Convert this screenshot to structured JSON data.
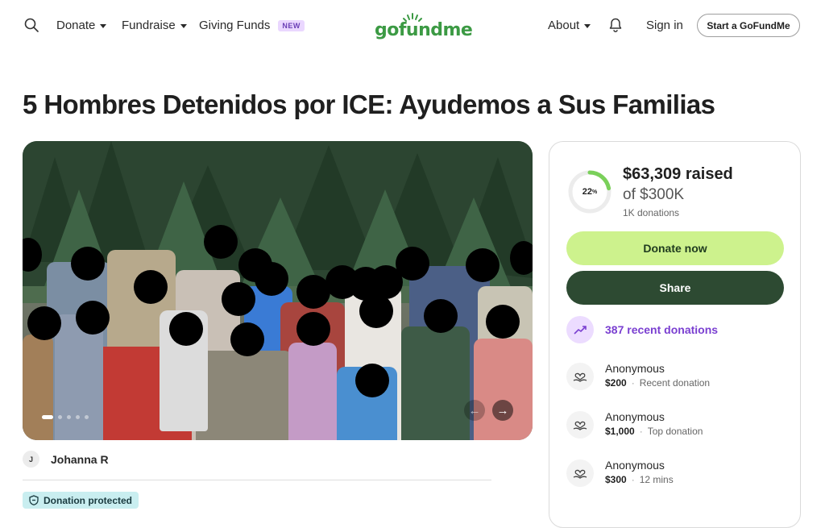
{
  "nav": {
    "donate": "Donate",
    "fundraise": "Fundraise",
    "giving_funds": "Giving Funds",
    "new_badge": "NEW",
    "logo": "gofundme",
    "about": "About",
    "sign_in": "Sign in",
    "start": "Start a GoFundMe"
  },
  "campaign": {
    "title": "5 Hombres Detenidos por ICE: Ayudemos a Sus Familias",
    "organizer_initial": "J",
    "organizer": "Johanna R",
    "protected": "Donation protected"
  },
  "progress": {
    "percent": 22,
    "percent_label": "22",
    "percent_sign": "%",
    "raised": "$63,309 raised",
    "goal": "of $300K",
    "donations": "1K donations"
  },
  "actions": {
    "donate": "Donate now",
    "share": "Share",
    "recent": "387 recent donations"
  },
  "donations": [
    {
      "name": "Anonymous",
      "amount": "$200",
      "note": "Recent donation"
    },
    {
      "name": "Anonymous",
      "amount": "$1,000",
      "note": "Top donation"
    },
    {
      "name": "Anonymous",
      "amount": "$300",
      "note": "12 mins"
    }
  ],
  "colors": {
    "brand": "#3c9a44",
    "donate": "#cdf28d",
    "share": "#2d4a32",
    "accent_purple": "#7a3fd1",
    "protected_bg": "#c9eef0"
  },
  "icons": [
    "search-icon",
    "chevron-down-icon",
    "bell-icon",
    "trending-up-icon",
    "heart-hand-icon",
    "shield-icon",
    "arrow-left-icon",
    "arrow-right-icon"
  ]
}
